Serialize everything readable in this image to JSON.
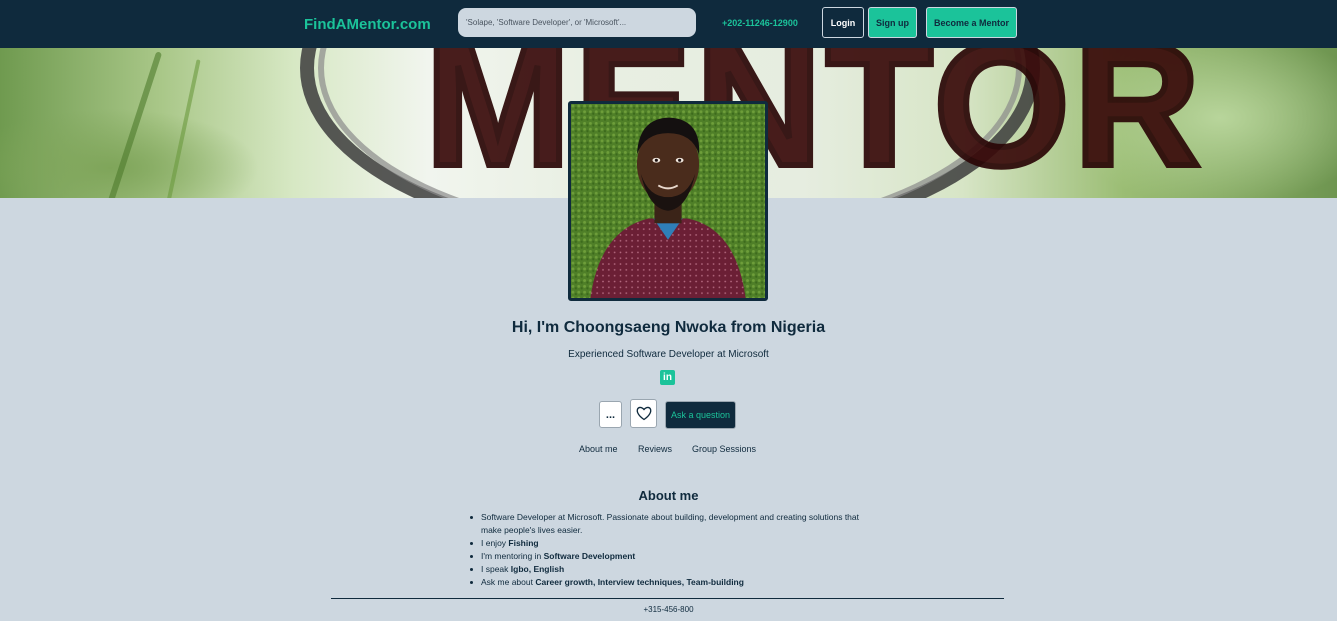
{
  "navbar": {
    "brand": "FindAMentor.com",
    "search_placeholder": "'Solape, 'Software Developer', or 'Microsoft'...",
    "phone": "+202-11246-12900",
    "login_label": "Login",
    "signup_label": "Sign up",
    "become_mentor_label": "Become a Mentor"
  },
  "banner": {
    "word": "MENTOR"
  },
  "profile": {
    "name": "Hi, I'm Choongsaeng Nwoka from Nigeria",
    "headline": "Experienced Software Developer at Microsoft",
    "linkedin_icon": "linkedin-icon",
    "more_label": "...",
    "favorite_icon": "heart-icon",
    "ask_label": "Ask a question"
  },
  "tabs": {
    "about": "About me",
    "reviews": "Reviews",
    "group": "Group Sessions"
  },
  "about": {
    "title": "About me",
    "items": [
      {
        "prefix": "Software Developer at Microsoft. Passionate about building, development and creating solutions that make people's lives easier.",
        "bold": ""
      },
      {
        "prefix": "I enjoy ",
        "bold": "Fishing"
      },
      {
        "prefix": "I'm mentoring in ",
        "bold": "Software Development"
      },
      {
        "prefix": "I speak ",
        "bold": "Igbo, English"
      },
      {
        "prefix": "Ask me about ",
        "bold": "Career growth, Interview techniques, Team-building"
      }
    ]
  },
  "footer": {
    "phone": "+315-456-800"
  },
  "colors": {
    "navy": "#0f2a3d",
    "accent": "#1bc39a",
    "page_bg": "#cdd7e0"
  }
}
